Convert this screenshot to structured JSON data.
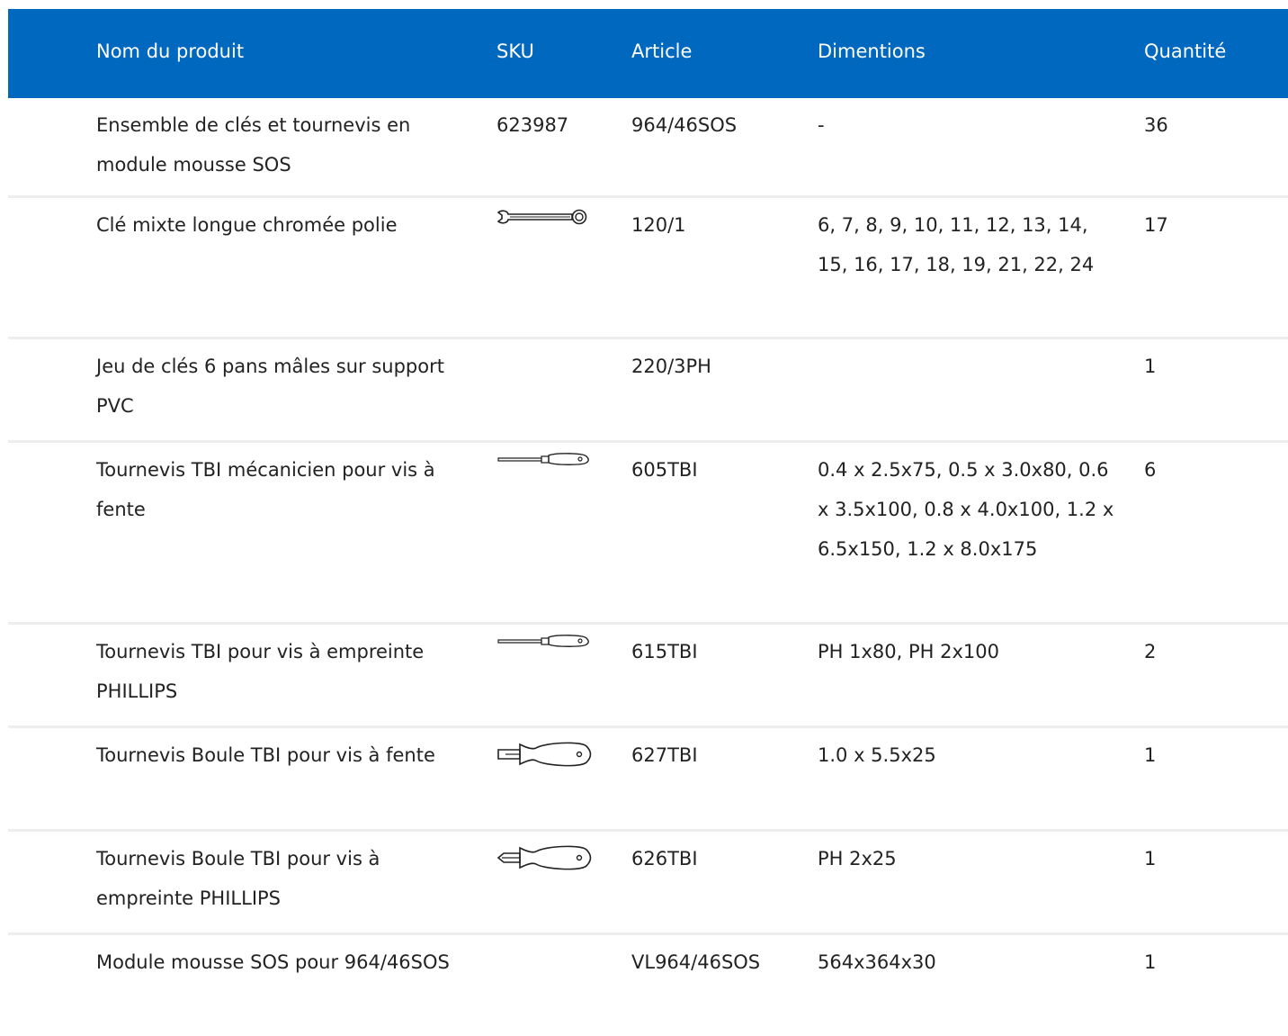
{
  "table": {
    "headers": {
      "name": "Nom du produit",
      "sku": "SKU",
      "article": "Article",
      "dimensions": "Dimentions",
      "quantity": "Quantité"
    },
    "rows": [
      {
        "name": "Ensemble de clés et tournevis en module mousse SOS",
        "sku": "623987",
        "sku_icon": "",
        "article": "964/46SOS",
        "dimensions": "-",
        "quantity": "36"
      },
      {
        "name": "Clé mixte longue chromée polie",
        "sku": "",
        "sku_icon": "combination-wrench-icon",
        "article": "120/1",
        "dimensions": "6, 7, 8, 9, 10, 11, 12, 13, 14, 15, 16, 17, 18, 19, 21, 22, 24",
        "quantity": "17"
      },
      {
        "name": "Jeu de clés 6 pans mâles sur support PVC",
        "sku": "",
        "sku_icon": "",
        "article": "220/3PH",
        "dimensions": "",
        "quantity": "1"
      },
      {
        "name": "Tournevis TBI mécanicien pour vis à fente",
        "sku": "",
        "sku_icon": "slotted-screwdriver-icon",
        "article": "605TBI",
        "dimensions": "0.4 x 2.5x75, 0.5 x 3.0x80, 0.6 x 3.5x100, 0.8 x 4.0x100, 1.2 x 6.5x150, 1.2 x 8.0x175",
        "quantity": "6"
      },
      {
        "name": "Tournevis TBI pour vis à empreinte PHILLIPS",
        "sku": "",
        "sku_icon": "phillips-screwdriver-icon",
        "article": "615TBI",
        "dimensions": "PH 1x80, PH 2x100",
        "quantity": "2"
      },
      {
        "name": "Tournevis Boule TBI pour vis à fente",
        "sku": "",
        "sku_icon": "stubby-slotted-screwdriver-icon",
        "article": "627TBI",
        "dimensions": "1.0 x 5.5x25",
        "quantity": "1"
      },
      {
        "name": "Tournevis Boule TBI pour vis à empreinte PHILLIPS",
        "sku": "",
        "sku_icon": "stubby-phillips-screwdriver-icon",
        "article": "626TBI",
        "dimensions": "PH 2x25",
        "quantity": "1"
      },
      {
        "name": "Module mousse SOS pour 964/46SOS",
        "sku": "",
        "sku_icon": "",
        "article": "VL964/46SOS",
        "dimensions": "564x364x30",
        "quantity": "1"
      }
    ]
  }
}
